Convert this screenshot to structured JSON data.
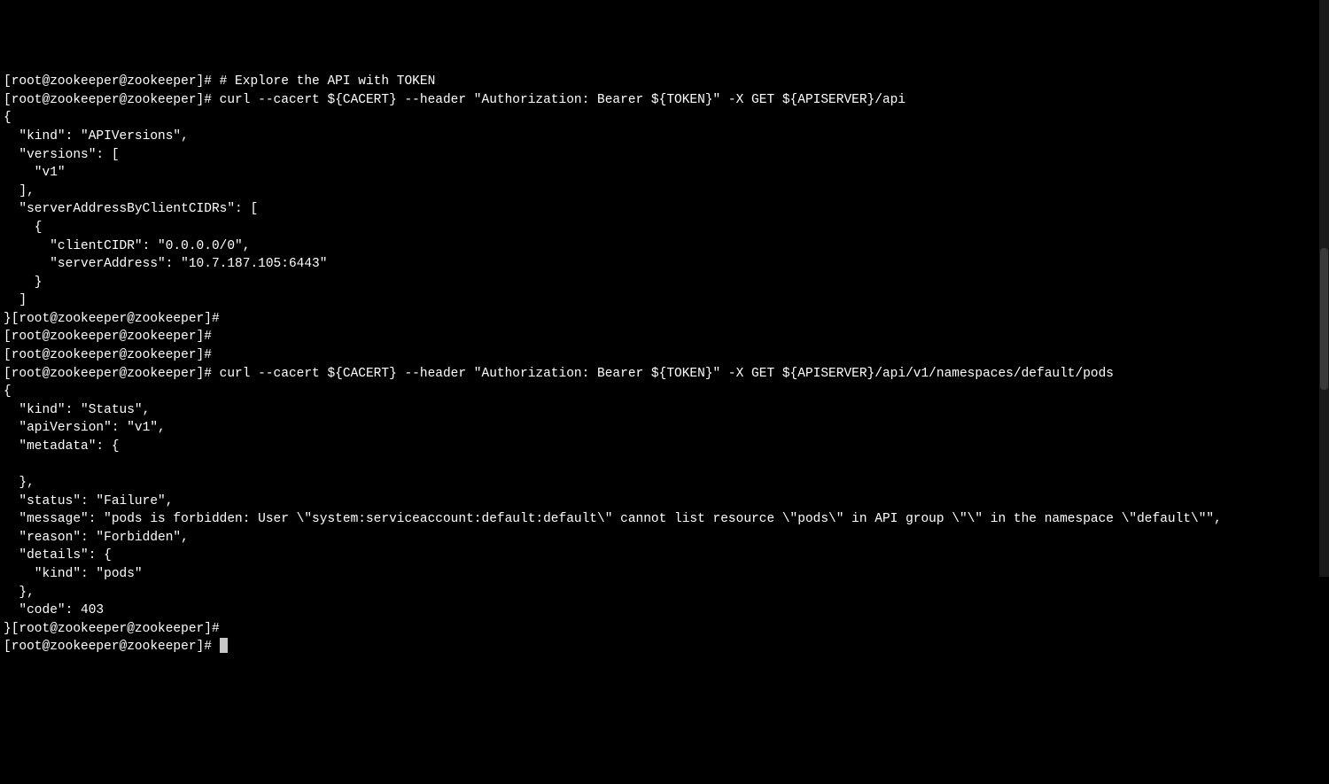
{
  "terminal": {
    "lines": [
      "[root@zookeeper@zookeeper]# # Explore the API with TOKEN",
      "[root@zookeeper@zookeeper]# curl --cacert ${CACERT} --header \"Authorization: Bearer ${TOKEN}\" -X GET ${APISERVER}/api",
      "{",
      "  \"kind\": \"APIVersions\",",
      "  \"versions\": [",
      "    \"v1\"",
      "  ],",
      "  \"serverAddressByClientCIDRs\": [",
      "    {",
      "      \"clientCIDR\": \"0.0.0.0/0\",",
      "      \"serverAddress\": \"10.7.187.105:6443\"",
      "    }",
      "  ]",
      "}[root@zookeeper@zookeeper]# ",
      "[root@zookeeper@zookeeper]# ",
      "[root@zookeeper@zookeeper]# ",
      "[root@zookeeper@zookeeper]# curl --cacert ${CACERT} --header \"Authorization: Bearer ${TOKEN}\" -X GET ${APISERVER}/api/v1/namespaces/default/pods",
      "{",
      "  \"kind\": \"Status\",",
      "  \"apiVersion\": \"v1\",",
      "  \"metadata\": {",
      "    ",
      "  },",
      "  \"status\": \"Failure\",",
      "  \"message\": \"pods is forbidden: User \\\"system:serviceaccount:default:default\\\" cannot list resource \\\"pods\\\" in API group \\\"\\\" in the namespace \\\"default\\\"\",",
      "  \"reason\": \"Forbidden\",",
      "  \"details\": {",
      "    \"kind\": \"pods\"",
      "  },",
      "  \"code\": 403",
      "}[root@zookeeper@zookeeper]# ",
      "[root@zookeeper@zookeeper]# "
    ]
  }
}
